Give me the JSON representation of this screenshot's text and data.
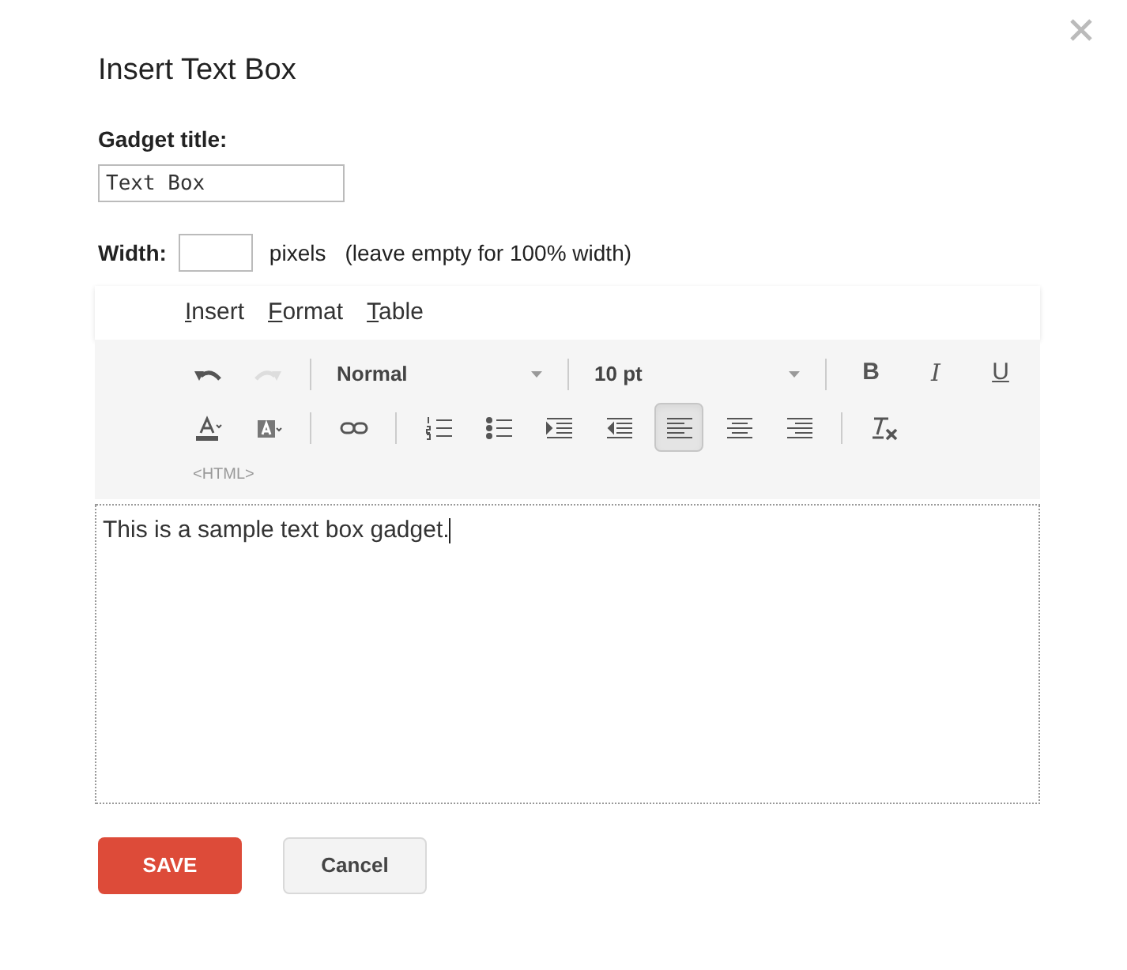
{
  "dialog": {
    "title": "Insert Text Box"
  },
  "gadget_title": {
    "label": "Gadget title:",
    "value": "Text Box"
  },
  "width": {
    "label": "Width:",
    "unit": "pixels",
    "hint": "(leave empty for 100% width)"
  },
  "menu": [
    "Insert",
    "Format",
    "Table"
  ],
  "toolbar": {
    "rows": [
      [
        {
          "kind": "tool",
          "disabled": false,
          "selected": false
        },
        {
          "kind": "tool",
          "disabled": true,
          "selected": false
        },
        {
          "kind": "select",
          "label": "Normal",
          "disabled": false,
          "selected": false
        },
        {
          "kind": "select",
          "label": "10 pt",
          "disabled": false,
          "selected": false
        },
        {
          "kind": "letter",
          "label": "B",
          "disabled": false,
          "selected": false
        },
        {
          "kind": "letter",
          "label": "I",
          "disabled": false,
          "selected": false
        },
        {
          "kind": "letter",
          "label": "U",
          "disabled": false,
          "selected": false
        }
      ],
      [
        {
          "kind": "tool",
          "disabled": false,
          "selected": false
        },
        {
          "kind": "tool",
          "disabled": false,
          "selected": false
        },
        {
          "kind": "tool",
          "disabled": false,
          "selected": false
        },
        {
          "kind": "tool",
          "disabled": false,
          "selected": false
        },
        {
          "kind": "tool",
          "disabled": false,
          "selected": false
        },
        {
          "kind": "tool",
          "disabled": false,
          "selected": false
        },
        {
          "kind": "tool",
          "disabled": false,
          "selected": false
        },
        {
          "kind": "tool",
          "disabled": false,
          "selected": true
        },
        {
          "kind": "tool",
          "disabled": false,
          "selected": false
        },
        {
          "kind": "tool",
          "disabled": false,
          "selected": false
        },
        {
          "kind": "tool",
          "disabled": false,
          "selected": false
        }
      ]
    ],
    "html_link": "<HTML>"
  },
  "editor": {
    "text": "This is a sample text box gadget."
  },
  "buttons": [
    {
      "kind": "primary",
      "label": "SAVE"
    },
    {
      "kind": "secondary",
      "label": "Cancel"
    }
  ]
}
